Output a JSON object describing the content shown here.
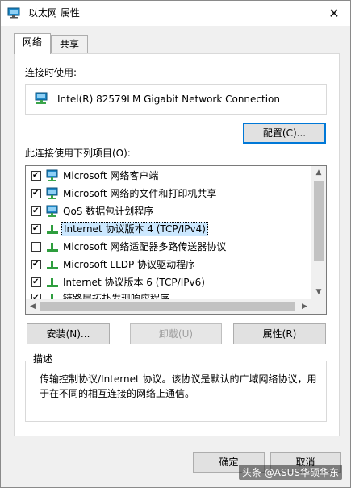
{
  "window": {
    "title": "以太网 属性",
    "close_glyph": "✕"
  },
  "tabs": [
    {
      "label": "网络",
      "active": true
    },
    {
      "label": "共享",
      "active": false
    }
  ],
  "connect_using": {
    "label": "连接时使用:",
    "adapter_name": "Intel(R) 82579LM Gigabit Network Connection"
  },
  "buttons": {
    "configure": "配置(C)...",
    "install": "安装(N)...",
    "uninstall": "卸载(U)",
    "properties": "属性(R)",
    "ok": "确定",
    "cancel": "取消"
  },
  "items_label": "此连接使用下列项目(O):",
  "items": [
    {
      "label": "Microsoft 网络客户端",
      "checked": true,
      "icon": "network-client-icon",
      "selected": false
    },
    {
      "label": "Microsoft 网络的文件和打印机共享",
      "checked": true,
      "icon": "network-client-icon",
      "selected": false
    },
    {
      "label": "QoS 数据包计划程序",
      "checked": true,
      "icon": "network-client-icon",
      "selected": false
    },
    {
      "label": "Internet 协议版本 4 (TCP/IPv4)",
      "checked": true,
      "icon": "protocol-icon",
      "selected": true
    },
    {
      "label": "Microsoft 网络适配器多路传送器协议",
      "checked": false,
      "icon": "protocol-icon",
      "selected": false
    },
    {
      "label": "Microsoft LLDP 协议驱动程序",
      "checked": true,
      "icon": "protocol-icon",
      "selected": false
    },
    {
      "label": "Internet 协议版本 6 (TCP/IPv6)",
      "checked": true,
      "icon": "protocol-icon",
      "selected": false
    },
    {
      "label": "链路层拓扑发现响应程序",
      "checked": true,
      "icon": "protocol-icon",
      "selected": false
    }
  ],
  "description": {
    "title": "描述",
    "text": "传输控制协议/Internet 协议。该协议是默认的广域网络协议，用于在不同的相互连接的网络上通信。"
  },
  "watermark": "头条 @ASUS华硕华东",
  "colors": {
    "selection": "#cce8ff",
    "focus_border": "#0078d7",
    "network_icon_blue": "#1e88c7",
    "protocol_icon_green": "#2e9e3e"
  }
}
